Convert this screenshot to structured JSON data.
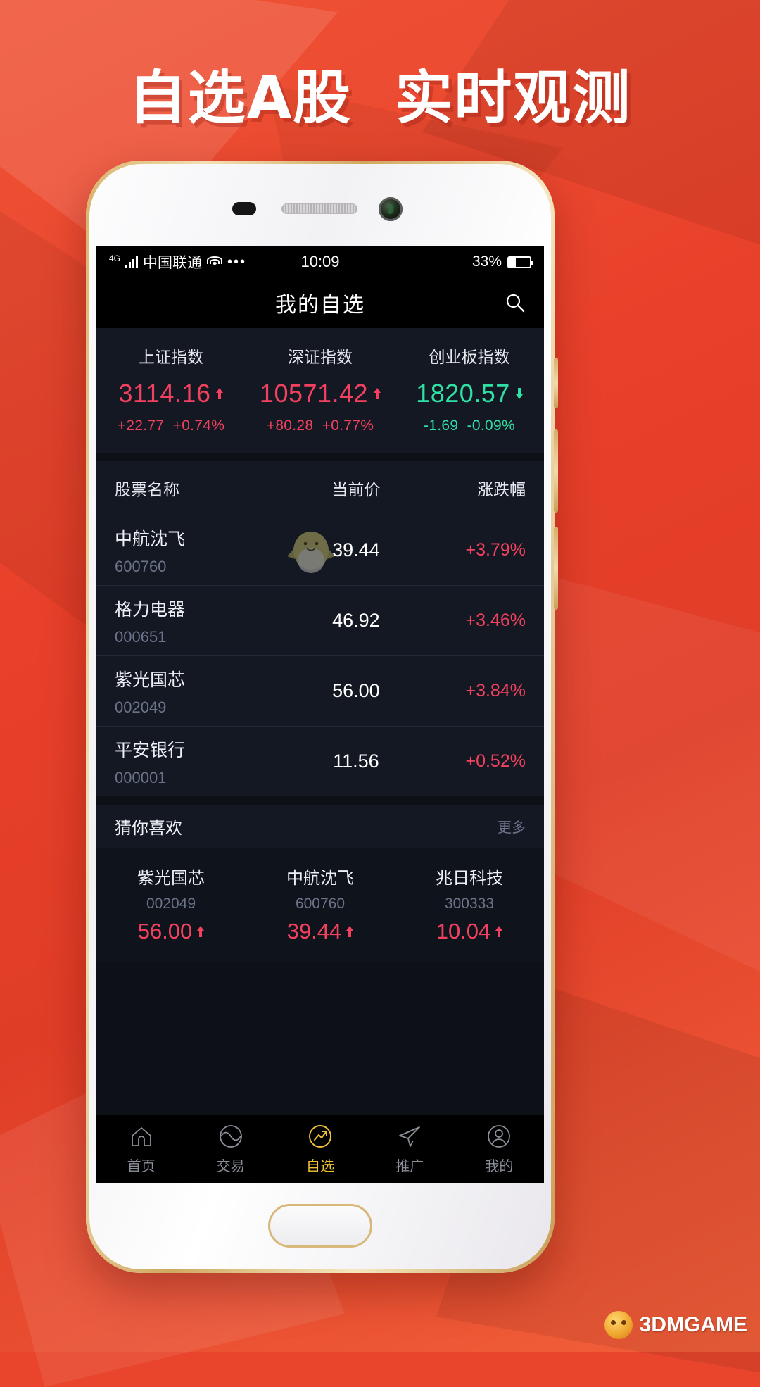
{
  "banner": {
    "headline": "自选A股  实时观测"
  },
  "watermark": {
    "text": "3DMGAME",
    "icon": "mascot-ball-icon"
  },
  "status_bar": {
    "network_type": "4G",
    "carrier": "中国联通",
    "wifi_icon": "wifi-icon",
    "more_icon": "•••",
    "time": "10:09",
    "battery_percent": "33%",
    "battery_level": 33
  },
  "nav": {
    "title": "我的自选",
    "search_icon": "search-icon"
  },
  "indices": [
    {
      "name": "上证指数",
      "value": "3114.16",
      "direction": "up",
      "change": "+22.77",
      "change_pct": "+0.74%"
    },
    {
      "name": "深证指数",
      "value": "10571.42",
      "direction": "up",
      "change": "+80.28",
      "change_pct": "+0.77%"
    },
    {
      "name": "创业板指数",
      "value": "1820.57",
      "direction": "down",
      "change": "-1.69",
      "change_pct": "-0.09%"
    }
  ],
  "table": {
    "headers": {
      "name": "股票名称",
      "price": "当前价",
      "change": "涨跌幅"
    },
    "rows": [
      {
        "name": "中航沈飞",
        "code": "600760",
        "price": "39.44",
        "change": "+3.79%",
        "direction": "up"
      },
      {
        "name": "格力电器",
        "code": "000651",
        "price": "46.92",
        "change": "+3.46%",
        "direction": "up"
      },
      {
        "name": "紫光国芯",
        "code": "002049",
        "price": "56.00",
        "change": "+3.84%",
        "direction": "up"
      },
      {
        "name": "平安银行",
        "code": "000001",
        "price": "11.56",
        "change": "+0.52%",
        "direction": "up"
      }
    ]
  },
  "recommend": {
    "title": "猜你喜欢",
    "more_label": "更多",
    "cards": [
      {
        "name": "紫光国芯",
        "code": "002049",
        "value": "56.00",
        "direction": "up"
      },
      {
        "name": "中航沈飞",
        "code": "600760",
        "value": "39.44",
        "direction": "up"
      },
      {
        "name": "兆日科技",
        "code": "300333",
        "value": "10.04",
        "direction": "up"
      }
    ]
  },
  "tabbar": {
    "items": [
      {
        "label": "首页",
        "icon": "home-icon",
        "active": false
      },
      {
        "label": "交易",
        "icon": "trade-wave-icon",
        "active": false
      },
      {
        "label": "自选",
        "icon": "watchlist-trend-icon",
        "active": true
      },
      {
        "label": "推广",
        "icon": "promote-plane-icon",
        "active": false
      },
      {
        "label": "我的",
        "icon": "user-profile-icon",
        "active": false
      }
    ]
  },
  "colors": {
    "up": "#f2415f",
    "down": "#2fe0a5",
    "accent": "#f2c335",
    "panel": "#141823",
    "screen_bg": "#0d1017"
  }
}
